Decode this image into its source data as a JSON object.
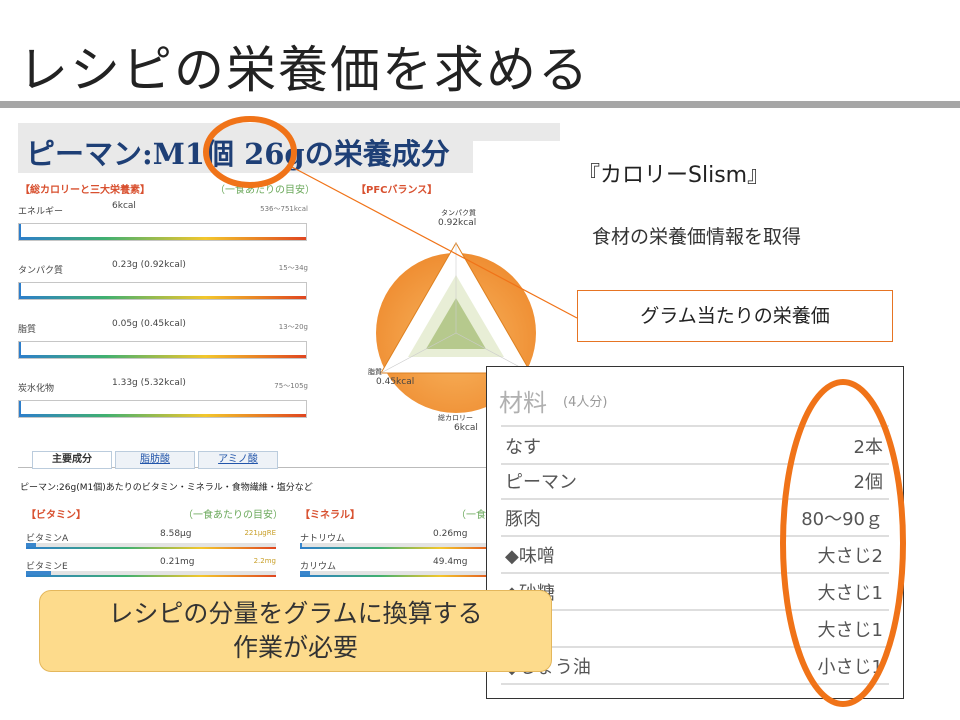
{
  "slide": {
    "title": "レシピの栄養価を求める"
  },
  "nutrition_screenshot": {
    "heading": "ピーマン:M1個 26gの栄養成分",
    "sections": {
      "macro": "【総カロリーと三大栄養素】",
      "per_meal": "（一食あたりの目安）",
      "pfc": "【PFCバランス】"
    },
    "macros": [
      {
        "name": "エネルギー",
        "value": "6kcal",
        "range": "536〜751kcal"
      },
      {
        "name": "タンパク質",
        "value": "0.23g (0.92kcal)",
        "range": "15〜34g"
      },
      {
        "name": "脂質",
        "value": "0.05g (0.45kcal)",
        "range": "13〜20g"
      },
      {
        "name": "炭水化物",
        "value": "1.33g (5.32kcal)",
        "range": "75〜105g"
      }
    ],
    "pfc": {
      "protein_label": "タンパク質",
      "protein_value": "0.92kcal",
      "fat_label": "脂質",
      "fat_value": "0.45kcal",
      "total_label": "総カロリー",
      "total_value": "6kcal"
    },
    "tabs": [
      "主要成分",
      "脂肪酸",
      "アミノ酸"
    ],
    "subtitle": "ピーマン:26g(M1個)あたりのビタミン・ミネラル・食物繊維・塩分など",
    "vitamin_header": "【ビタミン】",
    "vitamin_note": "（一食あたりの目安）",
    "vitamins": [
      {
        "name": "ビタミンA",
        "value": "8.58μg",
        "range": "221μgRE",
        "fill": 0.04
      },
      {
        "name": "ビタミンE",
        "value": "0.21mg",
        "range": "2.2mg",
        "fill": 0.1
      }
    ],
    "mineral_header": "【ミネラル】",
    "mineral_note": "（一食",
    "minerals": [
      {
        "name": "ナトリウム",
        "value": "0.26mg",
        "fill": 0.01
      },
      {
        "name": "カリウム",
        "value": "49.4mg",
        "fill": 0.05
      }
    ]
  },
  "source": {
    "name": "『カロリーSlism』",
    "description": "食材の栄養価情報を取得"
  },
  "callout": {
    "text": "グラム当たりの栄養価"
  },
  "recipe": {
    "title": "材料",
    "servings": "(4人分)",
    "items": [
      {
        "name": "なす",
        "amount": "2本"
      },
      {
        "name": "ピーマン",
        "amount": "2個"
      },
      {
        "name": "豚肉",
        "amount": "80〜90ｇ"
      },
      {
        "name": "◆味噌",
        "amount": "大さじ2"
      },
      {
        "name": "◆砂糖",
        "amount": "大さじ1"
      },
      {
        "name": "",
        "amount": "大さじ1"
      },
      {
        "name": "◆しょう油",
        "amount": "小さじ1"
      }
    ]
  },
  "note": {
    "line1": "レシピの分量をグラムに換算する",
    "line2": "作業が必要"
  },
  "colors": {
    "accent": "#f07318",
    "title_rule": "#a6a6a6",
    "heading": "#1e3f76",
    "note_bg": "#fddb8c"
  }
}
